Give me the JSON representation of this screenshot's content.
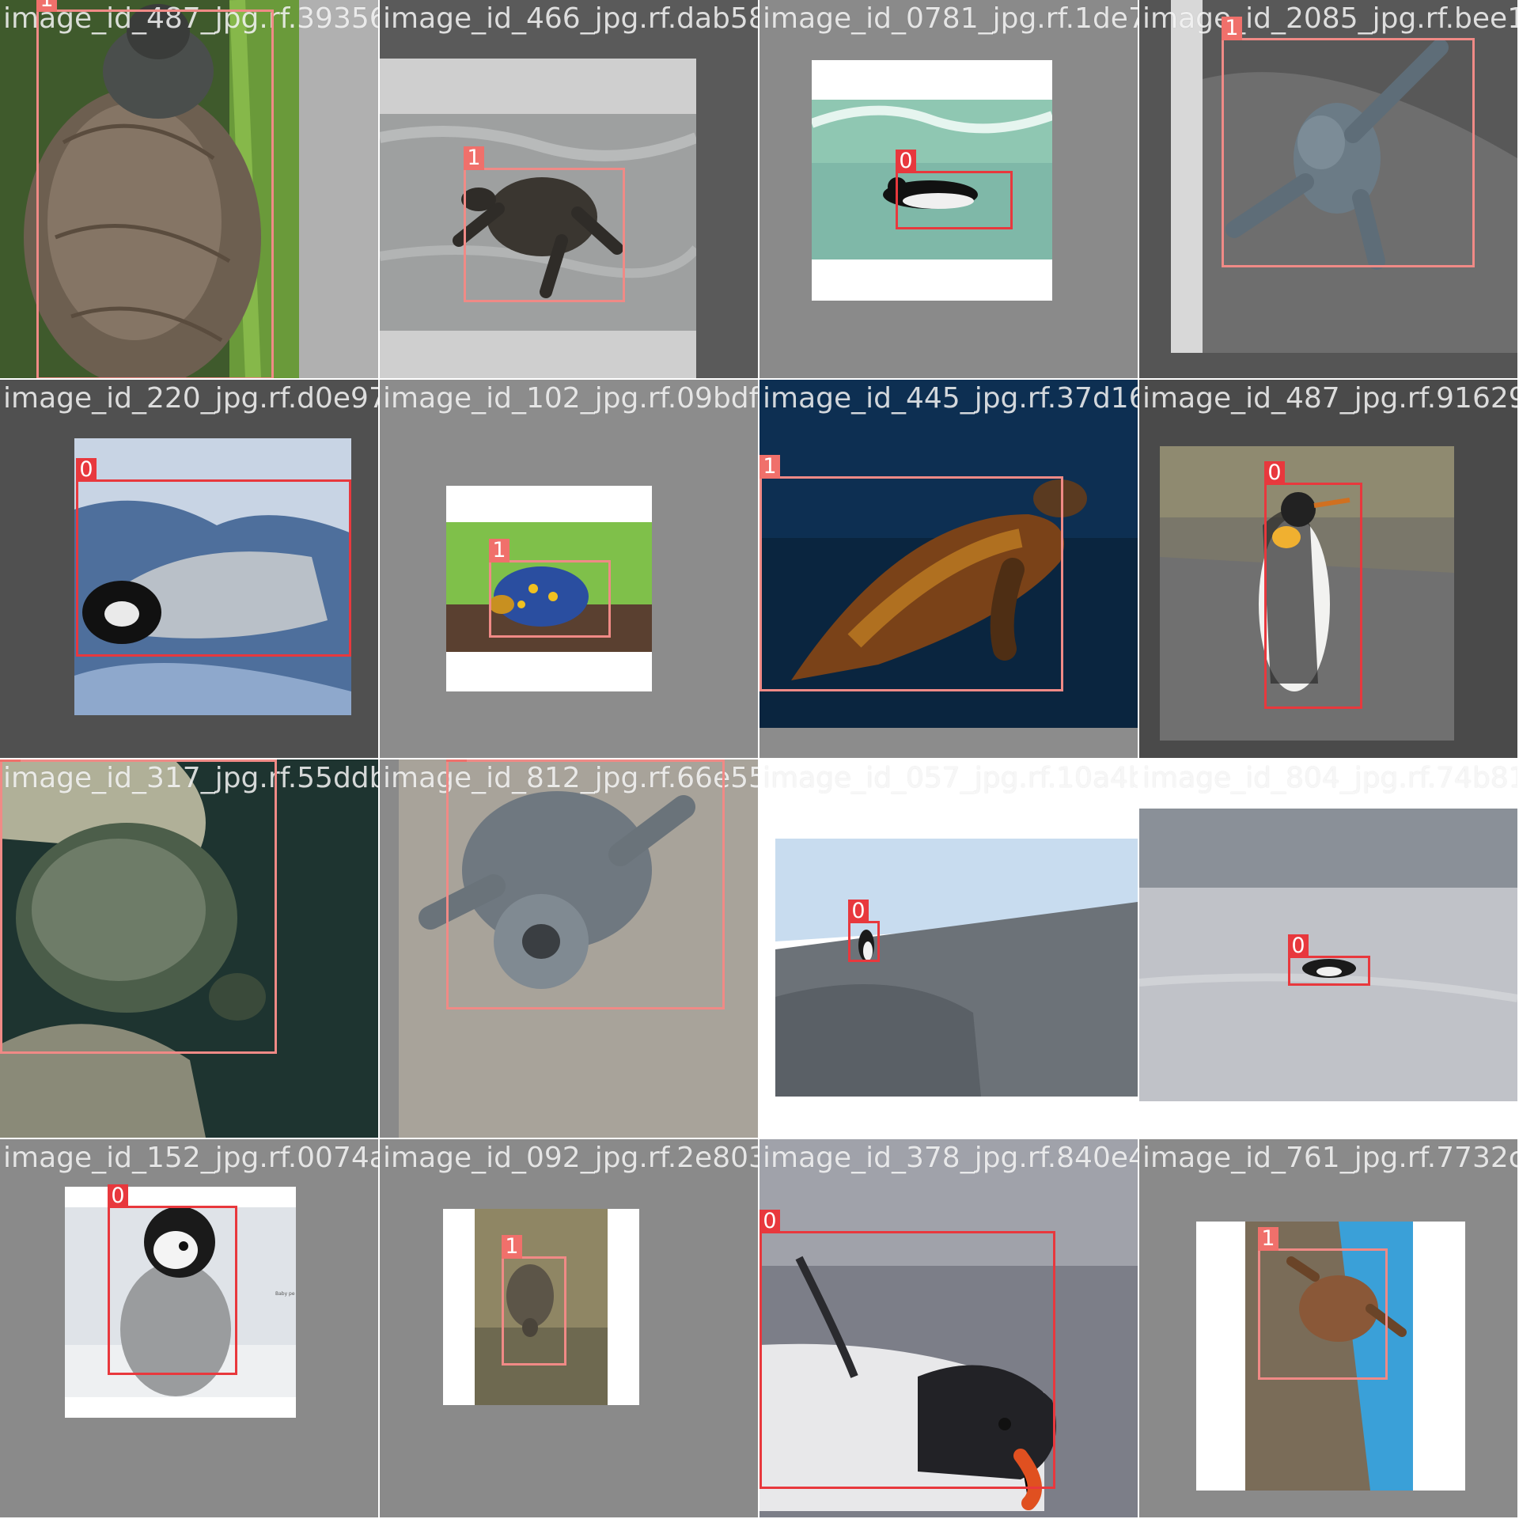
{
  "mosaic": {
    "classes": {
      "0": "0",
      "1": "1"
    },
    "colors": {
      "class0": "#e8383d",
      "class1": "#f08a86"
    },
    "tiles": [
      {
        "file": "image_id_487_jpg.rf.39356fe1780fe1a0466a",
        "boxes": [
          "1"
        ],
        "bg": "#b0b0b0",
        "subject": "tortoise"
      },
      {
        "file": "image_id_466_jpg.rf.dab58c1583de72b0813d",
        "boxes": [
          "1"
        ],
        "bg": "#5a5a5a",
        "subject": "sea-turtle"
      },
      {
        "file": "image_id_0781_jpg.rf.1de7e65f6e72885f9",
        "boxes": [
          "0"
        ],
        "bg": "#8a8a8a",
        "subject": "penguin-swimming"
      },
      {
        "file": "image_id_2085_jpg.rf.bee12",
        "boxes": [
          "1"
        ],
        "bg": "#555555",
        "subject": "hatchling"
      },
      {
        "file": "image_id_220_jpg.rf.d0e979f4929700e3072",
        "boxes": [
          "0"
        ],
        "bg": "#505050",
        "subject": "emperor-chick-lying"
      },
      {
        "file": "image_id_102_jpg.rf.09bdfa0182ca54a4418a",
        "boxes": [
          "1"
        ],
        "bg": "#8c8c8c",
        "subject": "box-turtle"
      },
      {
        "file": "image_id_445_jpg.rf.37d1657f1ae0b204874",
        "boxes": [
          "1"
        ],
        "bg": "#111f2f",
        "subject": "sea-turtle-blue"
      },
      {
        "file": "image_id_487_jpg.rf.91629a",
        "boxes": [
          "0"
        ],
        "bg": "#4a4a4a",
        "subject": "king-penguin"
      },
      {
        "file": "image_id_317_jpg.rf.55ddb06a7d5a2d4812",
        "boxes": [
          "1"
        ],
        "bg": "#20302a",
        "subject": "turtle-rock"
      },
      {
        "file": "image_id_812_jpg.rf.66e55d1deb7fb7d0571",
        "boxes": [
          "1"
        ],
        "bg": "#8a8a8a",
        "subject": "hatchling-sand"
      },
      {
        "file": "image_id_057_jpg.rf.10a4b4caf1e4fe804",
        "boxes": [
          "0"
        ],
        "bg": "#ffffff",
        "subject": "penguin-rocks"
      },
      {
        "file": "image_id_804_jpg.rf.74b81d",
        "boxes": [
          "0"
        ],
        "bg": "#ffffff",
        "subject": "penguin-ice"
      },
      {
        "file": "image_id_152_jpg.rf.0074adc9a76b037092d",
        "boxes": [
          "0"
        ],
        "bg": "#8a8a8a",
        "subject": "chick-standing"
      },
      {
        "file": "image_id_092_jpg.rf.2e803bca29b3b3378da",
        "boxes": [
          "1"
        ],
        "bg": "#8a8a8a",
        "subject": "tortoise-grass"
      },
      {
        "file": "image_id_378_jpg.rf.840e4c22da208261760",
        "boxes": [
          "0"
        ],
        "bg": "#6a6a72",
        "subject": "gentoo-closeup"
      },
      {
        "file": "image_id_761_jpg.rf.7732c4",
        "boxes": [
          "1"
        ],
        "bg": "#8a8a8a",
        "subject": "turtle-reef"
      }
    ]
  }
}
